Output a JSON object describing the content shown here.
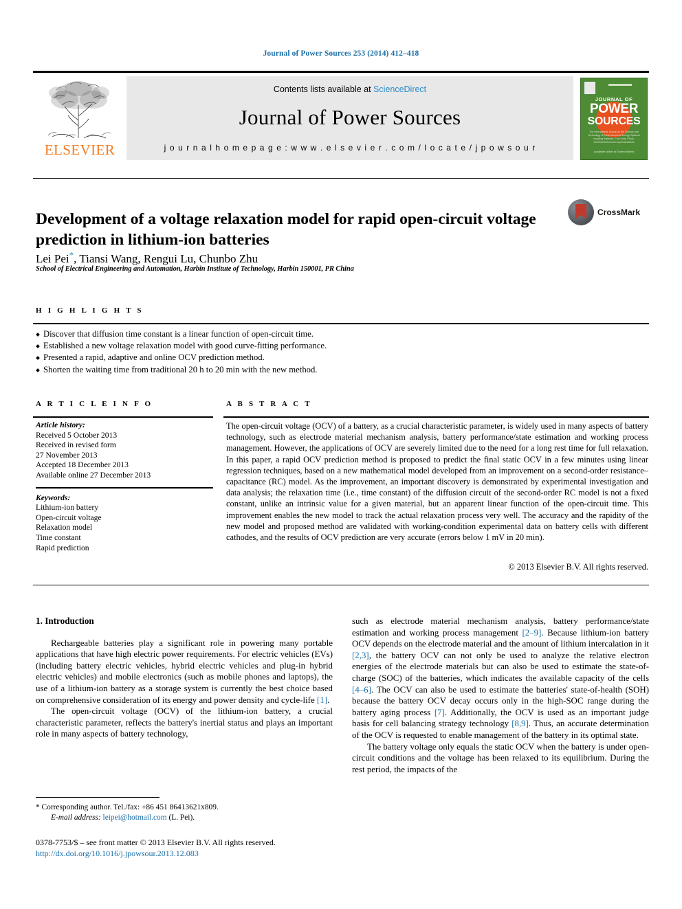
{
  "running_head": "Journal of Power Sources 253 (2014) 412–418",
  "masthead": {
    "publisher_name": "ELSEVIER",
    "contents_prefix": "Contents lists available at ",
    "contents_link": "ScienceDirect",
    "journal_title": "Journal of Power Sources",
    "homepage": "j o u r n a l   h o m e p a g e :   w w w . e l s e v i e r . c o m / l o c a t e / j p o w s o u r",
    "cover": {
      "line1": "JOURNAL OF",
      "line2": "POWER",
      "line3": "SOURCES",
      "blurb": "The International Journal on the Science and Technology of Electrochemical Energy Systems including Batteries, Fuel Cells, Photo-electrochemical and Supercapacitors",
      "footer": "Available online at ScienceDirect"
    }
  },
  "article": {
    "title": "Development of a voltage relaxation model for rapid open-circuit voltage prediction in lithium-ion batteries",
    "authors": "Lei Pei, Tiansi Wang, Rengui Lu, Chunbo Zhu",
    "author_star": "*",
    "affiliation": "School of Electrical Engineering and Automation, Harbin Institute of Technology, Harbin 150001, PR China",
    "crossmark_label": "CrossMark"
  },
  "highlights": {
    "label": "H I G H L I G H T S",
    "items": [
      "Discover that diffusion time constant is a linear function of open-circuit time.",
      "Established a new voltage relaxation model with good curve-fitting performance.",
      "Presented a rapid, adaptive and online OCV prediction method.",
      "Shorten the waiting time from traditional 20 h to 20 min with the new method."
    ]
  },
  "article_info": {
    "label": "A R T I C L E   I N F O",
    "history_heading": "Article history:",
    "history": [
      "Received 5 October 2013",
      "Received in revised form",
      "27 November 2013",
      "Accepted 18 December 2013",
      "Available online 27 December 2013"
    ],
    "keywords_heading": "Keywords:",
    "keywords": [
      "Lithium-ion battery",
      "Open-circuit voltage",
      "Relaxation model",
      "Time constant",
      "Rapid prediction"
    ]
  },
  "abstract": {
    "label": "A B S T R A C T",
    "text": "The open-circuit voltage (OCV) of a battery, as a crucial characteristic parameter, is widely used in many aspects of battery technology, such as electrode material mechanism analysis, battery performance/state estimation and working process management. However, the applications of OCV are severely limited due to the need for a long rest time for full relaxation. In this paper, a rapid OCV prediction method is proposed to predict the final static OCV in a few minutes using linear regression techniques, based on a new mathematical model developed from an improvement on a second-order resistance–capacitance (RC) model. As the improvement, an important discovery is demonstrated by experimental investigation and data analysis; the relaxation time (i.e., time constant) of the diffusion circuit of the second-order RC model is not a fixed constant, unlike an intrinsic value for a given material, but an apparent linear function of the open-circuit time. This improvement enables the new model to track the actual relaxation process very well. The accuracy and the rapidity of the new model and proposed method are validated with working-condition experimental data on battery cells with different cathodes, and the results of OCV prediction are very accurate (errors below 1 mV in 20 min).",
    "copyright": "© 2013 Elsevier B.V. All rights reserved."
  },
  "body": {
    "section_heading": "1. Introduction",
    "left_paragraphs": [
      "Rechargeable batteries play a significant role in powering many portable applications that have high electric power requirements. For electric vehicles (EVs) (including battery electric vehicles, hybrid electric vehicles and plug-in hybrid electric vehicles) and mobile electronics (such as mobile phones and laptops), the use of a lithium-ion battery as a storage system is currently the best choice based on comprehensive consideration of its energy and power density and cycle-life [1].",
      "The open-circuit voltage (OCV) of the lithium-ion battery, a crucial characteristic parameter, reflects the battery's inertial status and plays an important role in many aspects of battery technology,"
    ],
    "right_paragraphs": [
      "such as electrode material mechanism analysis, battery performance/state estimation and working process management [2–9]. Because lithium-ion battery OCV depends on the electrode material and the amount of lithium intercalation in it [2,3], the battery OCV can not only be used to analyze the relative electron energies of the electrode materials but can also be used to estimate the state-of-charge (SOC) of the batteries, which indicates the available capacity of the cells [4–6]. The OCV can also be used to estimate the batteries' state-of-health (SOH) because the battery OCV decay occurs only in the high-SOC range during the battery aging process [7]. Additionally, the OCV is used as an important judge basis for cell balancing strategy technology [8,9]. Thus, an accurate determination of the OCV is requested to enable management of the battery in its optimal state.",
      "The battery voltage only equals the static OCV when the battery is under open-circuit conditions and the voltage has been relaxed to its equilibrium. During the rest period, the impacts of the"
    ]
  },
  "footnotes": {
    "corresponding": "* Corresponding author. Tel./fax: +86 451 86413621x809.",
    "email_label": "E-mail address:",
    "email": "leipei@hotmail.com",
    "email_suffix": "(L. Pei).",
    "imprint": "0378-7753/$ – see front matter © 2013 Elsevier B.V. All rights reserved.",
    "doi": "http://dx.doi.org/10.1016/j.jpowsour.2013.12.083"
  },
  "colors": {
    "link": "#1a6fa8",
    "sciencedirect": "#2a8cc8",
    "elsevier_orange": "#F47C20",
    "cover_green": "#4d8b34"
  }
}
